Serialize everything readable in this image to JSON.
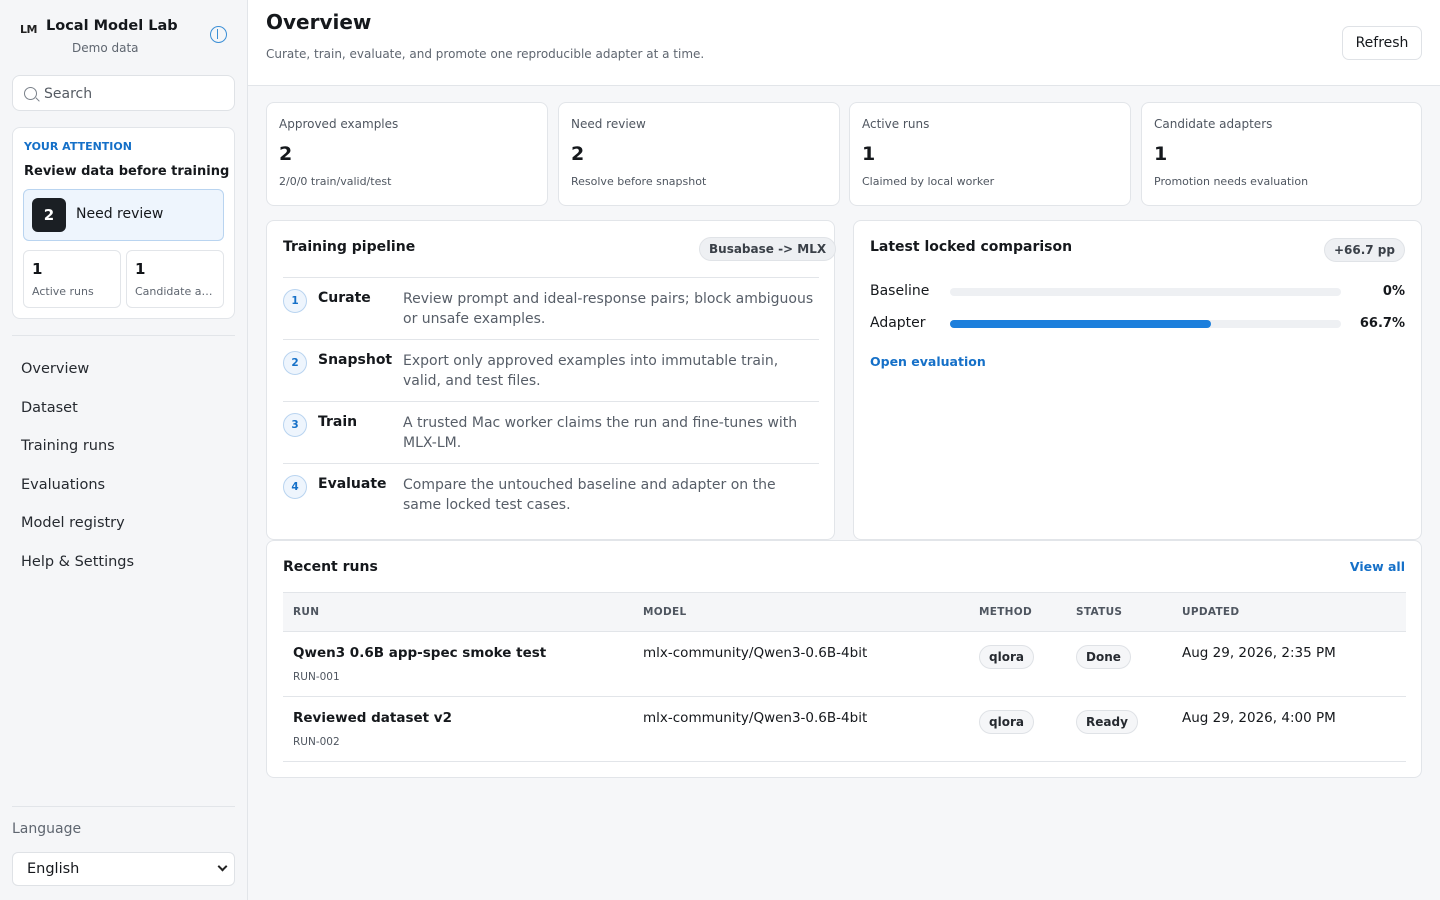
{
  "app": {
    "logo": "LM",
    "name": "Local Model Lab",
    "subtitle": "Demo data"
  },
  "search": {
    "placeholder": "Search"
  },
  "attention": {
    "eyebrow": "YOUR ATTENTION",
    "title": "Review data before training",
    "primary": {
      "count": "2",
      "label": "Need review"
    },
    "secondary": [
      {
        "count": "1",
        "label": "Active runs"
      },
      {
        "count": "1",
        "label": "Candidate adapters"
      }
    ]
  },
  "nav": [
    "Overview",
    "Dataset",
    "Training runs",
    "Evaluations",
    "Model registry",
    "Help & Settings"
  ],
  "language": {
    "label": "Language",
    "value": "English"
  },
  "header": {
    "title": "Overview",
    "subtitle": "Curate, train, evaluate, and promote one reproducible adapter at a time.",
    "refresh_label": "Refresh"
  },
  "stats": [
    {
      "label": "Approved examples",
      "value": "2",
      "sub": "2/0/0 train/valid/test"
    },
    {
      "label": "Need review",
      "value": "2",
      "sub": "Resolve before snapshot"
    },
    {
      "label": "Active runs",
      "value": "1",
      "sub": "Claimed by local worker"
    },
    {
      "label": "Candidate adapters",
      "value": "1",
      "sub": "Promotion needs evaluation"
    }
  ],
  "pipeline": {
    "title": "Training pipeline",
    "badge": "Busabase -> MLX",
    "steps": [
      {
        "num": "1",
        "name": "Curate",
        "desc": "Review prompt and ideal-response pairs; block ambiguous or unsafe examples."
      },
      {
        "num": "2",
        "name": "Snapshot",
        "desc": "Export only approved examples into immutable train, valid, and test files."
      },
      {
        "num": "3",
        "name": "Train",
        "desc": "A trusted Mac worker claims the run and fine-tunes with MLX-LM."
      },
      {
        "num": "4",
        "name": "Evaluate",
        "desc": "Compare the untouched baseline and adapter on the same locked test cases."
      }
    ]
  },
  "comparison": {
    "title": "Latest locked comparison",
    "delta": "+66.7 pp",
    "rows": [
      {
        "label": "Baseline",
        "value": "0%",
        "fraction": 0
      },
      {
        "label": "Adapter",
        "value": "66.7%",
        "fraction": 0.667
      }
    ],
    "link": "Open evaluation"
  },
  "recent_runs": {
    "title": "Recent runs",
    "view_all": "View all",
    "columns": [
      "RUN",
      "MODEL",
      "METHOD",
      "STATUS",
      "UPDATED"
    ],
    "rows": [
      {
        "name": "Qwen3 0.6B app-spec smoke test",
        "id": "RUN-001",
        "model": "mlx-community/Qwen3-0.6B-4bit",
        "method": "qlora",
        "status": "Done",
        "updated": "Aug 29, 2026, 2:35 PM"
      },
      {
        "name": "Reviewed dataset v2",
        "id": "RUN-002",
        "model": "mlx-community/Qwen3-0.6B-4bit",
        "method": "qlora",
        "status": "Ready",
        "updated": "Aug 29, 2026, 4:00 PM"
      }
    ]
  },
  "colors": {
    "accent": "#1570c8",
    "bar_fill": "#1c7fdc",
    "dark_badge": "#1b1f24"
  }
}
